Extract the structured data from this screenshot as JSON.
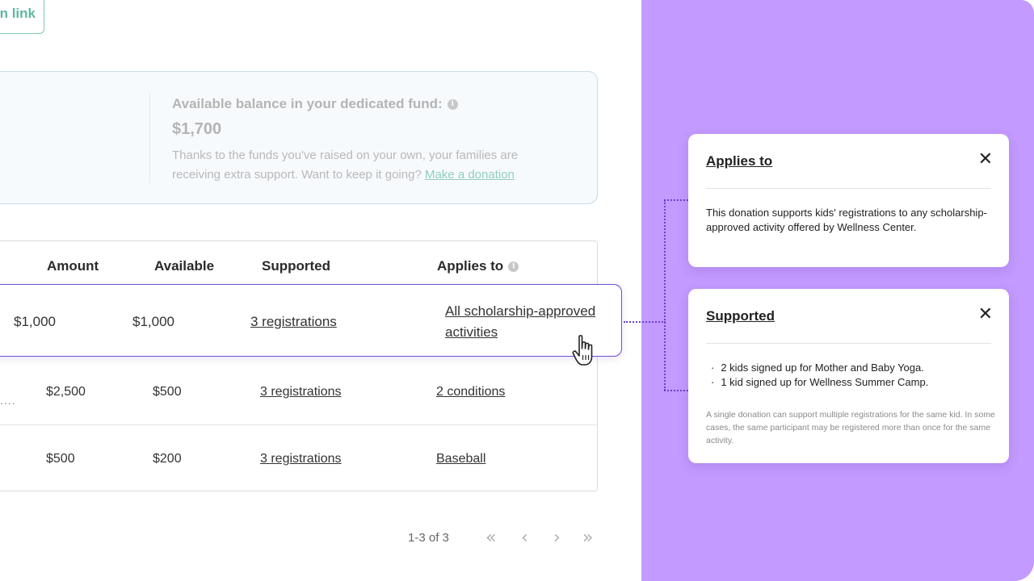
{
  "top_button": {
    "label": "n link"
  },
  "fund": {
    "title": "Available balance in your dedicated fund:",
    "amount": "$1,700",
    "description": "Thanks to the funds you've raised on your own, your families are receiving extra support. Want to keep it going?",
    "link": "Make a donation"
  },
  "table": {
    "headers": {
      "amount": "Amount",
      "available": "Available",
      "supported": "Supported",
      "applies_to": "Applies to"
    },
    "rows": [
      {
        "amount": "$1,000",
        "available": "$1,000",
        "supported": "3 registrations",
        "applies_to_line1": "All scholarship-approved",
        "applies_to_line2": "activities"
      },
      {
        "prefix": "....",
        "amount": "$2,500",
        "available": "$500",
        "supported": "3 registrations",
        "applies_to": "2 conditions"
      },
      {
        "amount": "$500",
        "available": "$200",
        "supported": "3 registrations",
        "applies_to": "Baseball"
      }
    ]
  },
  "pagination": {
    "range": "1-3 of 3"
  },
  "popovers": {
    "applies_to": {
      "title": "Applies to",
      "body": "This donation supports kids' registrations to any scholarship-approved activity offered by Wellness Center."
    },
    "supported": {
      "title": "Supported",
      "items": [
        "2 kids signed up for Mother and Baby Yoga.",
        "1 kid signed up for Wellness Summer Camp."
      ],
      "note": "A single donation can support multiple registrations for the same kid. In some cases, the same participant may be registered more than once for the same activity."
    }
  },
  "colors": {
    "accent": "#6f4fd8",
    "panel": "#c39aff",
    "link_green": "#5fb89f"
  }
}
